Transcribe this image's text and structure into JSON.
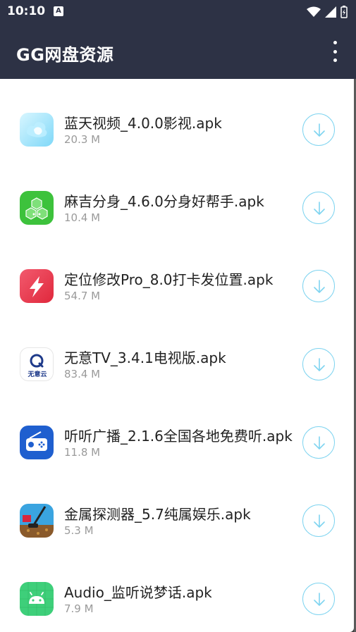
{
  "status": {
    "time": "10:10",
    "notif": "A"
  },
  "appbar": {
    "title": "GG网盘资源"
  },
  "files": [
    {
      "name": "蓝天视频_4.0.0影视.apk",
      "size": "20.3 M",
      "icon": "cloud-app-icon"
    },
    {
      "name": "麻吉分身_4.6.0分身好帮手.apk",
      "size": "10.4 M",
      "icon": "hexagon-app-icon"
    },
    {
      "name": "定位修改Pro_8.0打卡发位置.apk",
      "size": "54.7 M",
      "icon": "location-app-icon"
    },
    {
      "name": "无意TV_3.4.1电视版.apk",
      "size": "83.4 M",
      "icon": "wuyi-app-icon",
      "icon_text": "无意云"
    },
    {
      "name": "听听广播_2.1.6全国各地免费听.apk",
      "size": "11.8 M",
      "icon": "radio-app-icon"
    },
    {
      "name": "金属探测器_5.7纯属娱乐.apk",
      "size": "5.3 M",
      "icon": "detector-app-icon"
    },
    {
      "name": "Audio_监听说梦话.apk",
      "size": "7.9 M",
      "icon": "android-app-icon"
    }
  ],
  "colors": {
    "appbar": "#2d3245",
    "accent": "#7fd4f0"
  }
}
